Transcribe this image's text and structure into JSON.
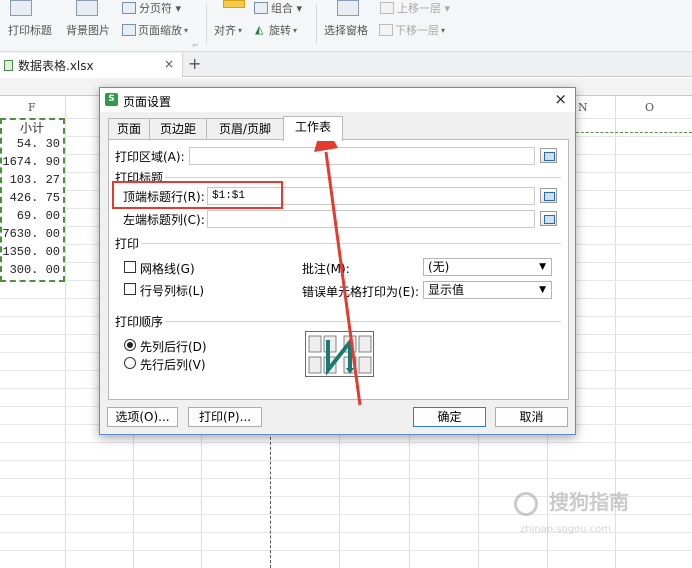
{
  "ribbon": {
    "top_items": [
      {
        "label": "分页符 ▾",
        "dim": false
      },
      {
        "label": "组合 ▾",
        "dim": false
      },
      {
        "label": "上移一层 ▾",
        "dim": true
      }
    ],
    "items": [
      {
        "label": "打印标题",
        "dim": false
      },
      {
        "label": "背景图片",
        "dim": false
      },
      {
        "label": "页面缩放",
        "dim": false
      },
      {
        "label": "对齐",
        "dim": false
      },
      {
        "label": "旋转",
        "dim": false
      },
      {
        "label": "选择窗格",
        "dim": false
      },
      {
        "label": "下移一层",
        "dim": true
      }
    ]
  },
  "file_tab": {
    "name": "数据表格.xlsx",
    "close": "×",
    "add": "+"
  },
  "sheet": {
    "column_headers": [
      "F",
      "N",
      "O"
    ],
    "cells": [
      "小计",
      "54. 30",
      "1674. 90",
      "103. 27",
      "426. 75",
      "69. 00",
      "7630. 00",
      "1350. 00",
      "300. 00"
    ]
  },
  "dialog": {
    "title": "页面设置",
    "close": "×",
    "tabs": [
      "页面",
      "页边距",
      "页眉/页脚",
      "工作表"
    ],
    "print_area_label": "打印区域(A):",
    "print_titles_label": "打印标题",
    "top_rows_label": "顶端标题行(R):",
    "top_rows_value": "$1:$1",
    "left_cols_label": "左端标题列(C):",
    "print_label": "打印",
    "gridlines_label": "网格线(G)",
    "row_col_label": "行号列标(L)",
    "comments_label": "批注(M):",
    "comments_value": "(无)",
    "errors_label": "错误单元格打印为(E):",
    "errors_value": "显示值",
    "order_label": "打印顺序",
    "down_then_over": "先列后行(D)",
    "over_then_down": "先行后列(V)",
    "options_button": "选项(O)...",
    "print_button": "打印(P)...",
    "ok_button": "确定",
    "cancel_button": "取消"
  },
  "watermark": {
    "text": "搜狗指南",
    "sub": "zhinan.sogou.com"
  },
  "colors": {
    "accent_green": "#2f9a48",
    "annotation_red": "#e23b2f",
    "dialog_border": "#5a8fc7"
  }
}
